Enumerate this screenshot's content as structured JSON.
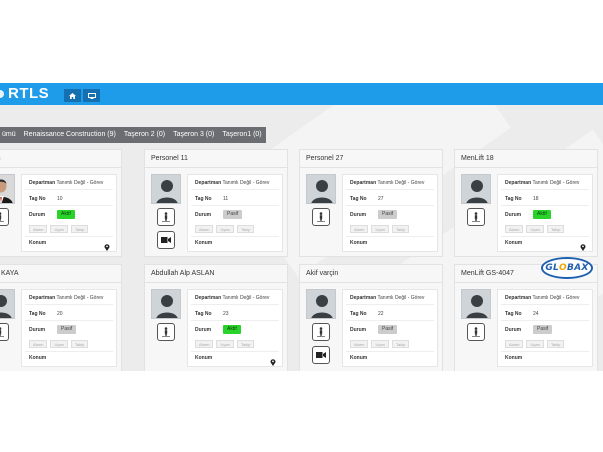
{
  "app": {
    "title": "RTLS"
  },
  "nav": [
    {
      "icon": "home-icon"
    },
    {
      "icon": "monitor-icon"
    }
  ],
  "tabs": [
    {
      "label": "ümü"
    },
    {
      "label": "Renaissance Construction (9)"
    },
    {
      "label": "Taşeron 2 (0)"
    },
    {
      "label": "Taşeron 3 (0)"
    },
    {
      "label": "Taşeron1 (0)"
    }
  ],
  "labels": {
    "department": "Departman",
    "tag": "Tag No",
    "status": "Durum",
    "location": "Konum",
    "buttons": [
      "Alarm",
      "Uyarı",
      "Takip"
    ]
  },
  "status_colors": {
    "aktif": "#2ad32a",
    "pasif": "#cccccc"
  },
  "brand": {
    "name": "GLOBAX"
  },
  "cards": [
    {
      "name": "i Baş",
      "department": "Tanımlı Değil - Görev",
      "tag": "10",
      "status": "Aktif",
      "photo": "person-photo",
      "extra_icon": null
    },
    {
      "name": "Personel 11",
      "department": "Tanımlı Değil - Görev",
      "tag": "11",
      "status": "Pasif",
      "photo": "user-silhouette",
      "extra_icon": "video-camera-icon"
    },
    {
      "name": "Personel 27",
      "department": "Tanımlı Değil - Görev",
      "tag": "27",
      "status": "Pasif",
      "photo": "user-silhouette",
      "extra_icon": null
    },
    {
      "name": "MenLift 18",
      "department": "Tanımlı Değil - Görev",
      "tag": "18",
      "status": "Aktif",
      "photo": "user-silhouette",
      "extra_icon": null
    },
    {
      "name": "rhan KAYA",
      "department": "Tanımlı Değil - Görev",
      "tag": "20",
      "status": "Pasif",
      "photo": "user-silhouette",
      "extra_icon": null
    },
    {
      "name": "Abdullah Alp ASLAN",
      "department": "Tanımlı Değil - Görev",
      "tag": "23",
      "status": "Aktif",
      "photo": "user-silhouette",
      "extra_icon": null
    },
    {
      "name": "Akif varçin",
      "department": "Tanımlı Değil - Görev",
      "tag": "22",
      "status": "Pasif",
      "photo": "user-silhouette",
      "extra_icon": "video-camera-icon"
    },
    {
      "name": "MenLift GS-4047",
      "department": "Tanımlı Değil - Görev",
      "tag": "24",
      "status": "Pasif",
      "photo": "user-silhouette",
      "extra_icon": null
    }
  ]
}
